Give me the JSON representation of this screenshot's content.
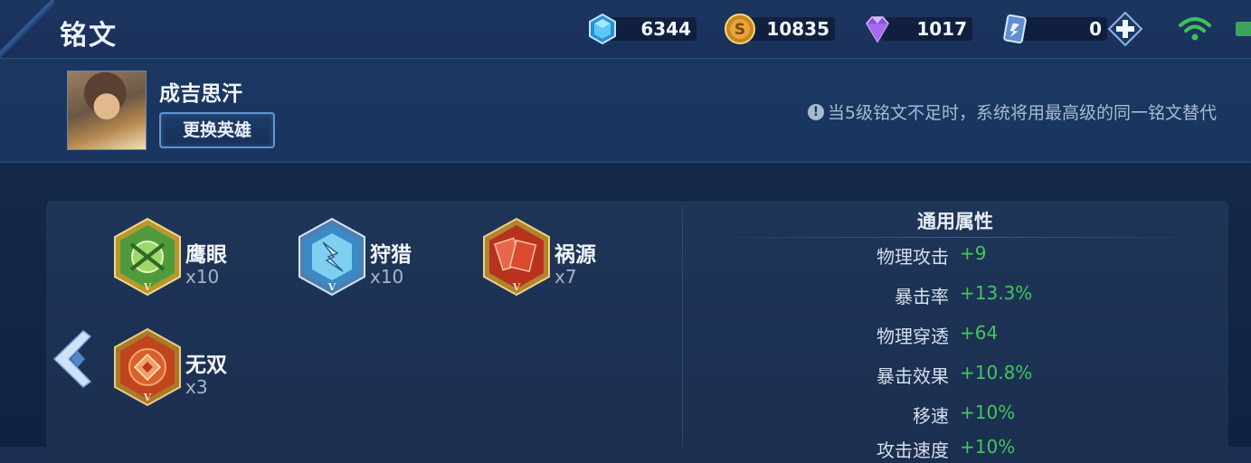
{
  "header": {
    "title": "铭文",
    "resources": [
      {
        "name": "diamond-crystal",
        "icon": "blue-crystal-icon",
        "value": "6344",
        "color": "#4fb8f0"
      },
      {
        "name": "gold",
        "icon": "gold-coin-icon",
        "value": "10835",
        "color": "#e0a030"
      },
      {
        "name": "gem",
        "icon": "purple-gem-icon",
        "value": "1017",
        "color": "#a46be8"
      },
      {
        "name": "voucher",
        "icon": "card-voucher-icon",
        "value": "0",
        "color": "#7ab0e8"
      }
    ],
    "add_icon": "plus-icon",
    "wifi_icon": "wifi-icon",
    "battery_icon": "battery-icon"
  },
  "hero": {
    "name": "成吉思汗",
    "change_button": "更换英雄",
    "notice": "当5级铭文不足时，系统将用最高级的同一铭文替代"
  },
  "runes": [
    {
      "name": "鹰眼",
      "count": "x10",
      "color": "green",
      "icon": "hawk-eye-rune-icon"
    },
    {
      "name": "狩猎",
      "count": "x10",
      "color": "blue",
      "icon": "hunt-rune-icon"
    },
    {
      "name": "祸源",
      "count": "x7",
      "color": "red",
      "icon": "calamity-rune-icon"
    },
    {
      "name": "无双",
      "count": "x3",
      "color": "red",
      "icon": "peerless-rune-icon"
    }
  ],
  "attributes": {
    "title": "通用属性",
    "items": [
      {
        "label": "物理攻击",
        "value": "+9"
      },
      {
        "label": "暴击率",
        "value": "+13.3%"
      },
      {
        "label": "物理穿透",
        "value": "+64"
      },
      {
        "label": "暴击效果",
        "value": "+10.8%"
      },
      {
        "label": "移速",
        "value": "+10%"
      },
      {
        "label": "攻击速度",
        "value": "+10%"
      }
    ]
  },
  "colors": {
    "accent_green": "#43c65c",
    "text_secondary": "#a9b9d2",
    "panel_bg": "#1b2f50"
  }
}
